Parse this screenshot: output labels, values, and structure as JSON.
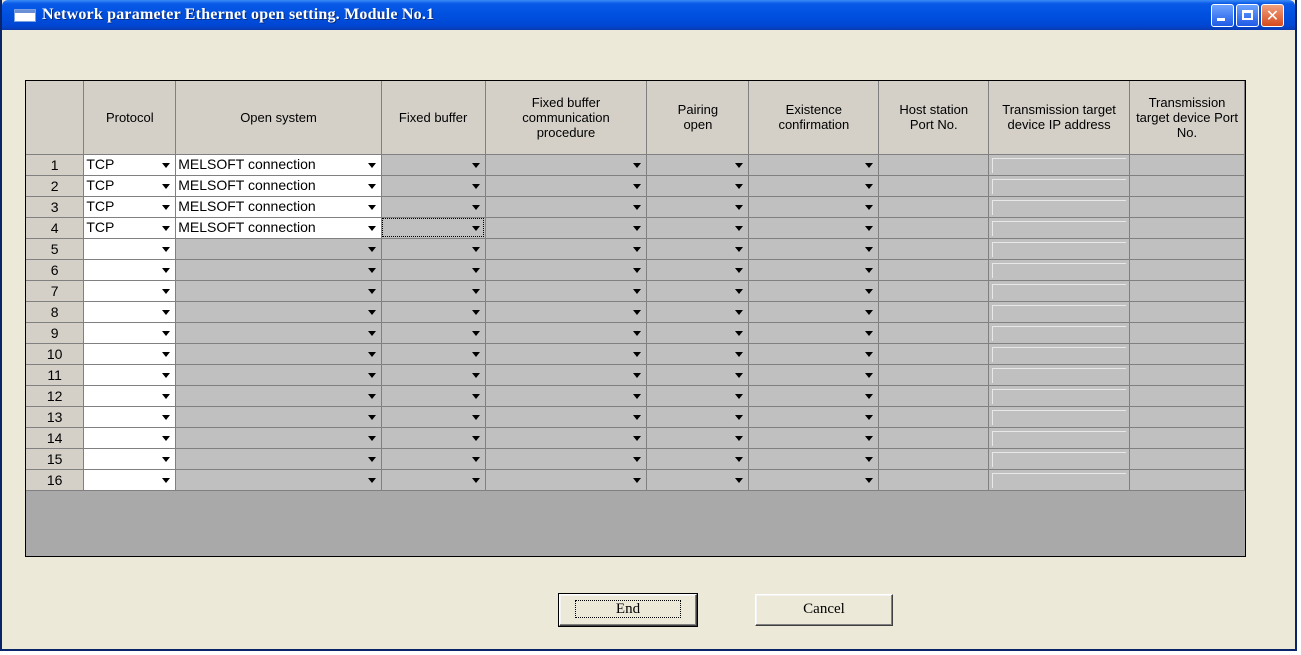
{
  "window": {
    "title": "Network parameter Ethernet open setting. Module No.1"
  },
  "columns": [
    "",
    "Protocol",
    "Open system",
    "Fixed buffer",
    "Fixed buffer communication procedure",
    "Pairing open",
    "Existence confirmation",
    "Host station Port No.",
    "Transmission target device IP address",
    "Transmission target device Port No."
  ],
  "rows": [
    {
      "num": "1",
      "protocol": "TCP",
      "open_system": "MELSOFT connection"
    },
    {
      "num": "2",
      "protocol": "TCP",
      "open_system": "MELSOFT connection"
    },
    {
      "num": "3",
      "protocol": "TCP",
      "open_system": "MELSOFT connection"
    },
    {
      "num": "4",
      "protocol": "TCP",
      "open_system": "MELSOFT connection"
    },
    {
      "num": "5",
      "protocol": "",
      "open_system": ""
    },
    {
      "num": "6",
      "protocol": "",
      "open_system": ""
    },
    {
      "num": "7",
      "protocol": "",
      "open_system": ""
    },
    {
      "num": "8",
      "protocol": "",
      "open_system": ""
    },
    {
      "num": "9",
      "protocol": "",
      "open_system": ""
    },
    {
      "num": "10",
      "protocol": "",
      "open_system": ""
    },
    {
      "num": "11",
      "protocol": "",
      "open_system": ""
    },
    {
      "num": "12",
      "protocol": "",
      "open_system": ""
    },
    {
      "num": "13",
      "protocol": "",
      "open_system": ""
    },
    {
      "num": "14",
      "protocol": "",
      "open_system": ""
    },
    {
      "num": "15",
      "protocol": "",
      "open_system": ""
    },
    {
      "num": "16",
      "protocol": "",
      "open_system": ""
    }
  ],
  "buttons": {
    "end": "End",
    "cancel": "Cancel"
  },
  "icons": {
    "dropdown": "chevron-down-icon",
    "close": "close-icon",
    "minimize": "minimize-icon",
    "maximize": "maximize-icon"
  }
}
